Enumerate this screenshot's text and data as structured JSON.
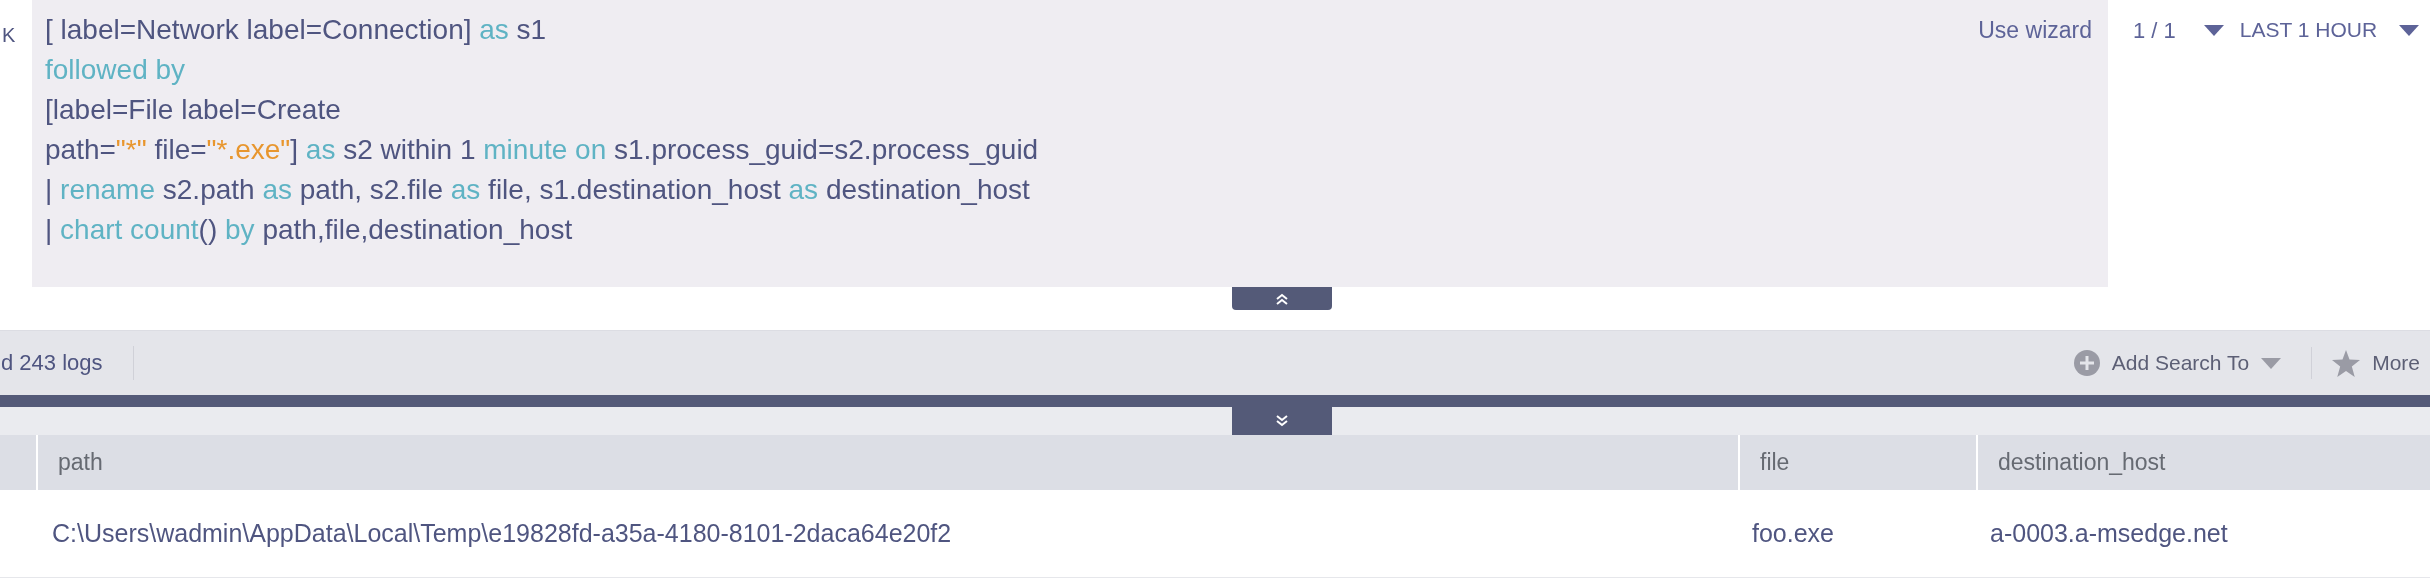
{
  "left_edge_text": "K",
  "query": {
    "lines": [
      [
        {
          "kind": "plain",
          "text": "[ label=Network label=Connection] "
        },
        {
          "kind": "keyword",
          "text": "as"
        },
        {
          "kind": "plain",
          "text": " s1"
        }
      ],
      [
        {
          "kind": "keyword",
          "text": "followed by"
        }
      ],
      [
        {
          "kind": "plain",
          "text": "[label=File label=Create"
        }
      ],
      [
        {
          "kind": "plain",
          "text": "path="
        },
        {
          "kind": "string",
          "text": "\"*\""
        },
        {
          "kind": "plain",
          "text": " file="
        },
        {
          "kind": "string",
          "text": "\"*.exe\""
        },
        {
          "kind": "plain",
          "text": "] "
        },
        {
          "kind": "keyword",
          "text": "as"
        },
        {
          "kind": "plain",
          "text": " s2 within 1 "
        },
        {
          "kind": "keyword",
          "text": "minute on"
        },
        {
          "kind": "plain",
          "text": " s1.process_guid=s2.process_guid"
        }
      ],
      [
        {
          "kind": "plain",
          "text": "| "
        },
        {
          "kind": "keyword",
          "text": "rename"
        },
        {
          "kind": "plain",
          "text": " s2.path "
        },
        {
          "kind": "keyword",
          "text": "as"
        },
        {
          "kind": "plain",
          "text": " path, s2.file "
        },
        {
          "kind": "keyword",
          "text": "as"
        },
        {
          "kind": "plain",
          "text": " file, s1.destination_host "
        },
        {
          "kind": "keyword",
          "text": "as"
        },
        {
          "kind": "plain",
          "text": " destination_host"
        }
      ],
      [
        {
          "kind": "plain",
          "text": "| "
        },
        {
          "kind": "keyword",
          "text": "chart count"
        },
        {
          "kind": "plain",
          "text": "() "
        },
        {
          "kind": "keyword",
          "text": "by"
        },
        {
          "kind": "plain",
          "text": " path,file,destination_host"
        }
      ]
    ],
    "wizard_link": "Use wizard"
  },
  "pager": "1 / 1",
  "time_range": "LAST 1 HOUR",
  "toolbar": {
    "log_count": "d 243 logs",
    "add_search": "Add Search To",
    "more": "More"
  },
  "table": {
    "columns": [
      "path",
      "file",
      "destination_host"
    ],
    "rows": [
      [
        "C:\\Users\\wadmin\\AppData\\Local\\Temp\\e19828fd-a35a-4180-8101-2daca64e20f2",
        "foo.exe",
        "a-0003.a-msedge.net"
      ]
    ]
  }
}
